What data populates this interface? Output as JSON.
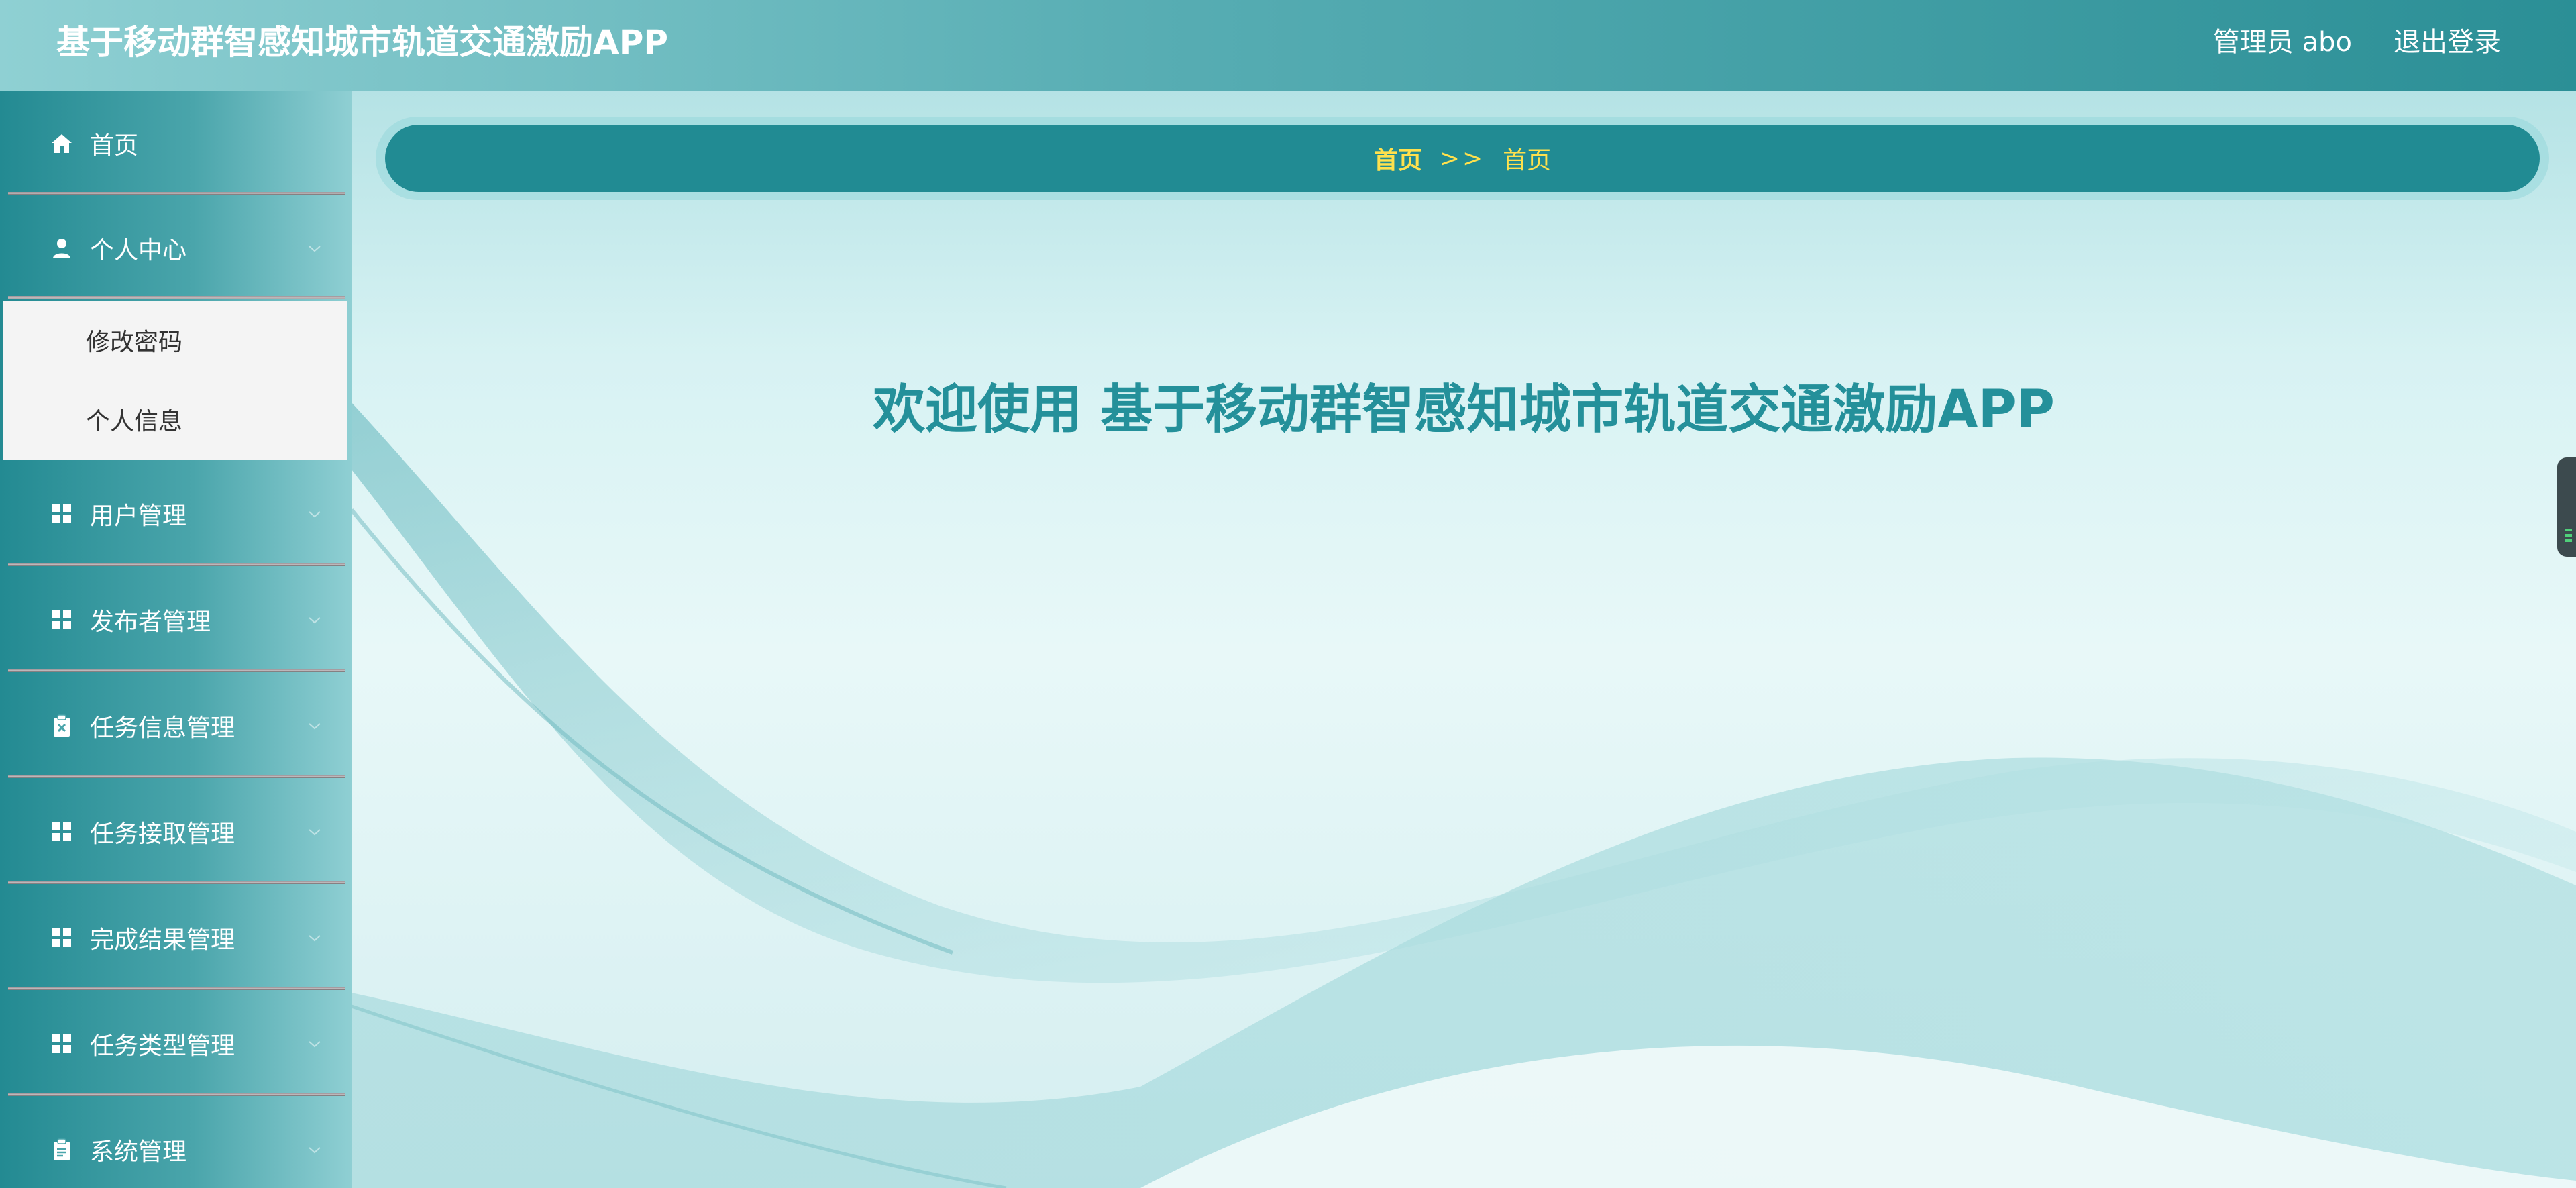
{
  "header": {
    "app_title": "基于移动群智感知城市轨道交通激励APP",
    "user_label": "管理员 abo",
    "logout_label": "退出登录"
  },
  "sidebar": {
    "items": [
      {
        "label": "首页",
        "icon": "home-icon"
      },
      {
        "label": "个人中心",
        "icon": "user-icon",
        "expanded": true,
        "children": [
          {
            "label": "修改密码"
          },
          {
            "label": "个人信息"
          }
        ]
      },
      {
        "label": "用户管理",
        "icon": "grid-icon"
      },
      {
        "label": "发布者管理",
        "icon": "grid-icon"
      },
      {
        "label": "任务信息管理",
        "icon": "clipboard-x-icon"
      },
      {
        "label": "任务接取管理",
        "icon": "grid-icon"
      },
      {
        "label": "完成结果管理",
        "icon": "grid-icon"
      },
      {
        "label": "任务类型管理",
        "icon": "grid-icon"
      },
      {
        "label": "系统管理",
        "icon": "clipboard-icon"
      }
    ]
  },
  "breadcrumb": {
    "home": "首页",
    "separator": ">>",
    "current": "首页"
  },
  "main": {
    "welcome_text": "欢迎使用 基于移动群智感知城市轨道交通激励APP"
  },
  "colors": {
    "accent": "#218b93",
    "breadcrumb_text": "#ffe14d",
    "welcome_text": "#24909a"
  }
}
